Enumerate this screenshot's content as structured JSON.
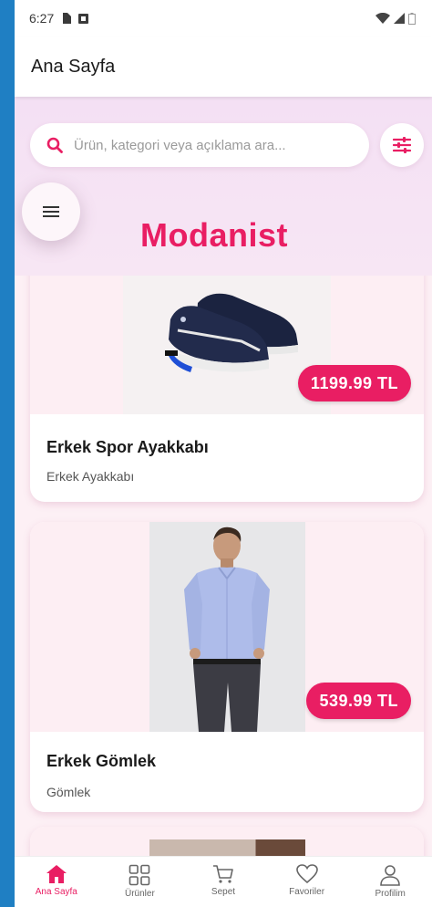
{
  "status_bar": {
    "time": "6:27"
  },
  "app_bar": {
    "title": "Ana Sayfa"
  },
  "search": {
    "placeholder": "Ürün, kategori veya açıklama ara..."
  },
  "brand": {
    "title": "Modanist"
  },
  "products": [
    {
      "name": "Erkek Spor Ayakkabı",
      "category": "Erkek Ayakkabı",
      "price": "1199.99 TL"
    },
    {
      "name": "Erkek Gömlek",
      "category": "Gömlek",
      "price": "539.99 TL"
    }
  ],
  "bottom_nav": [
    {
      "label": "Ana Sayfa",
      "icon": "home-icon",
      "active": true
    },
    {
      "label": "Ürünler",
      "icon": "grid-icon",
      "active": false
    },
    {
      "label": "Sepet",
      "icon": "cart-icon",
      "active": false
    },
    {
      "label": "Favoriler",
      "icon": "heart-icon",
      "active": false
    },
    {
      "label": "Profilim",
      "icon": "user-icon",
      "active": false
    }
  ],
  "colors": {
    "accent": "#e91e63",
    "background": "#fdf0f5",
    "header": "#f4e0f4"
  }
}
